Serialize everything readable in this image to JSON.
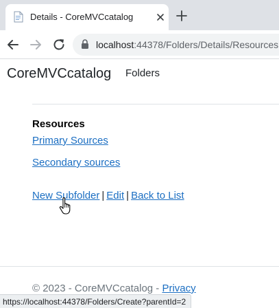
{
  "browser": {
    "tab_title": "Details - CoreMVCcatalog",
    "url_host": "localhost",
    "url_rest": ":44378/Folders/Details/Resources",
    "icons": [
      "page-favicon-icon",
      "close-icon",
      "plus-icon",
      "back-arrow-icon",
      "forward-arrow-icon",
      "reload-icon",
      "lock-icon"
    ],
    "status_url": "https://localhost:44378/Folders/Create?parentId=2"
  },
  "header": {
    "brand": "CoreMVCcatalog",
    "nav_folders": "Folders"
  },
  "main": {
    "section_title": "Resources",
    "links": {
      "primary": "Primary Sources",
      "secondary": "Secondary sources"
    },
    "actions": {
      "new_subfolder": "New Subfolder",
      "edit": "Edit",
      "back_to_list": "Back to List",
      "separator": "|"
    }
  },
  "footer": {
    "copyright": "© 2023 - CoreMVCcatalog - ",
    "privacy": "Privacy"
  },
  "colors": {
    "link": "#1b6ec2",
    "tabstrip": "#dee1e6",
    "omnibox": "#f1f3f4"
  }
}
